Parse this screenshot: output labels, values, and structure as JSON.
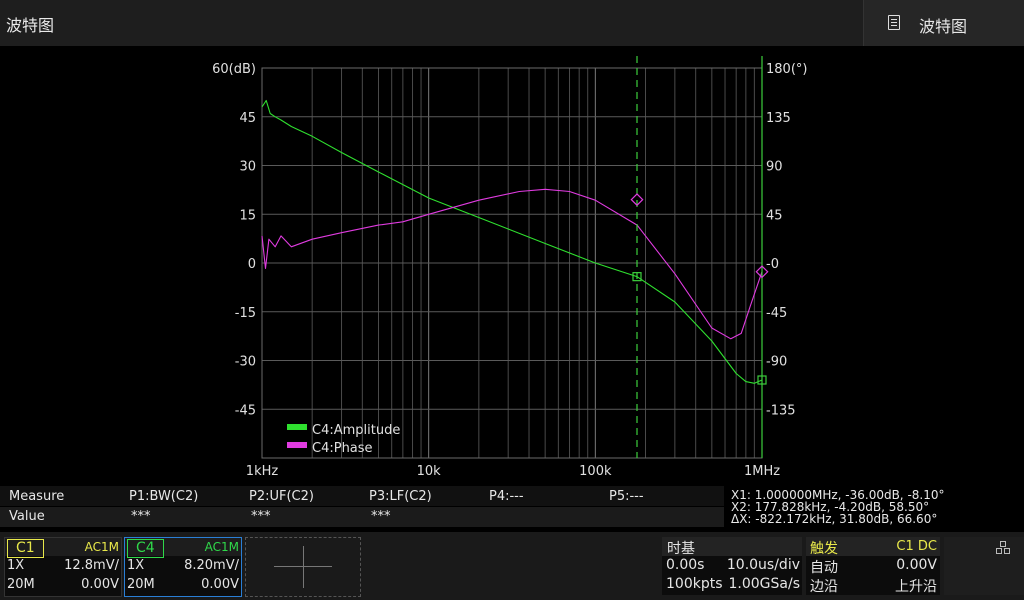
{
  "app": {
    "title": "波特图",
    "tab_label": "波特图"
  },
  "chart_data": {
    "type": "line",
    "x_scale": "log",
    "x_range": [
      1000,
      1000000
    ],
    "x_ticks": [
      "1kHz",
      "10k",
      "100k",
      "1MHz"
    ],
    "left_axis": {
      "unit_label": "60(dB)",
      "range": [
        -60,
        60
      ],
      "ticks": [
        "45",
        "30",
        "15",
        "0",
        "-15",
        "-30",
        "-45"
      ]
    },
    "right_axis": {
      "unit_label": "180(°)",
      "range": [
        -180,
        180
      ],
      "ticks": [
        "135",
        "90",
        "45",
        "-0",
        "-45",
        "-90",
        "-135"
      ]
    },
    "grid": true,
    "legend": {
      "placement": "bottom-left",
      "items": [
        "C4:Amplitude",
        "C4:Phase"
      ]
    },
    "series": [
      {
        "name": "C4:Amplitude",
        "axis": "left",
        "color": "#2fe02f",
        "x": [
          1000,
          1060,
          1120,
          1200,
          1300,
          1500,
          2000,
          3000,
          5000,
          10000,
          20000,
          50000,
          100000,
          178000,
          300000,
          500000,
          700000,
          800000,
          900000,
          1000000
        ],
        "y": [
          48,
          50,
          46,
          45,
          44,
          42,
          39,
          34,
          28,
          20,
          14,
          6,
          0,
          -4.2,
          -12,
          -24,
          -34,
          -36.5,
          -37,
          -36
        ]
      },
      {
        "name": "C4:Phase",
        "axis": "right",
        "color": "#e03be0",
        "x": [
          1000,
          1050,
          1100,
          1200,
          1300,
          1500,
          2000,
          3000,
          5000,
          7000,
          10000,
          20000,
          35000,
          50000,
          70000,
          100000,
          178000,
          300000,
          500000,
          650000,
          750000,
          850000,
          1000000
        ],
        "y": [
          25,
          -5,
          22,
          15,
          25,
          15,
          22,
          28,
          35,
          38,
          45,
          58,
          66,
          68,
          66,
          58,
          35,
          -10,
          -60,
          -70,
          -65,
          -40,
          -8
        ]
      }
    ],
    "cursors": [
      {
        "name": "X1",
        "x": 1000000,
        "amp": -36.0,
        "phase": -8.1,
        "style": "solid"
      },
      {
        "name": "X2",
        "x": 177828,
        "amp": -4.2,
        "phase": 58.5,
        "style": "dashed"
      }
    ]
  },
  "measure": {
    "headers": [
      "Measure",
      "P1:BW(C2)",
      "P2:UF(C2)",
      "P3:LF(C2)",
      "P4:---",
      "P5:---"
    ],
    "values": [
      "Value",
      "***",
      "***",
      "***"
    ]
  },
  "cursor_readout": {
    "x1": "X1: 1.000000MHz, -36.00dB, -8.10°",
    "x2": "X2: 177.828kHz, -4.20dB, 58.50°",
    "dx": "ΔX: -822.172kHz, 31.80dB, 66.60°"
  },
  "channels": [
    {
      "name": "C1",
      "coupling": "AC1M",
      "probe": "1X",
      "scale": "12.8mV/",
      "bw": "20M",
      "offset": "0.00V",
      "color": "#e8e84a"
    },
    {
      "name": "C4",
      "coupling": "AC1M",
      "probe": "1X",
      "scale": "8.20mV/",
      "bw": "20M",
      "offset": "0.00V",
      "color": "#2fd84a"
    }
  ],
  "timebase": {
    "title": "时基",
    "delay": "0.00s",
    "scale": "10.0us/div",
    "memory": "100kpts",
    "rate": "1.00GSa/s"
  },
  "trigger": {
    "title": "触发",
    "source": "C1 DC",
    "mode": "自动",
    "level": "0.00V",
    "type": "边沿",
    "slope": "上升沿",
    "accent": "#e8e84a"
  },
  "icons": {
    "tab": "document-icon",
    "util": "network-icon"
  }
}
